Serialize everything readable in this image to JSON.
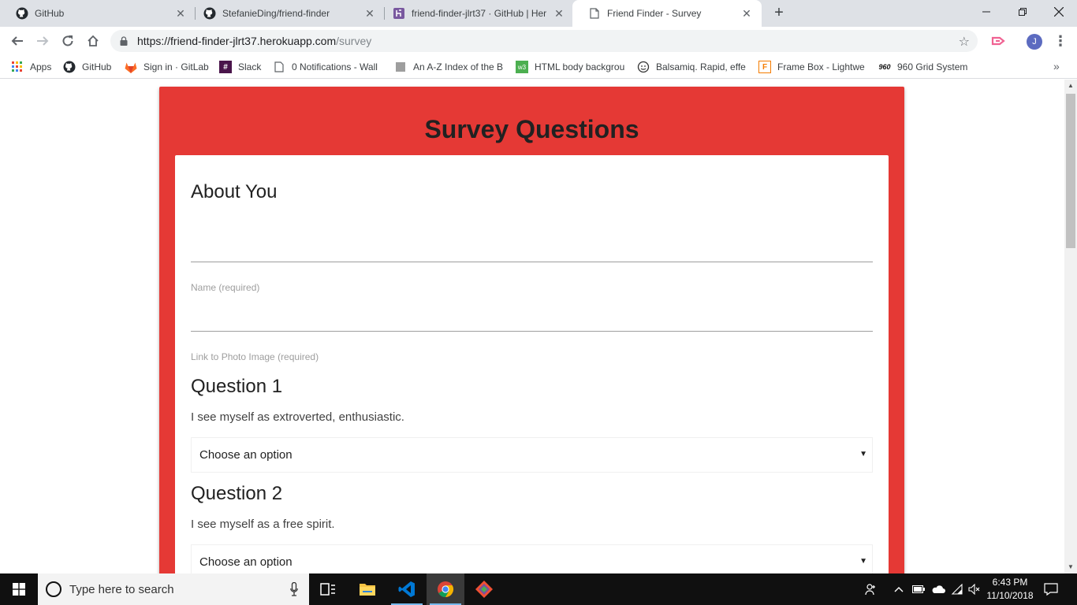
{
  "browser": {
    "tabs": [
      {
        "title": "GitHub",
        "icon": "github-icon",
        "active": false
      },
      {
        "title": "StefanieDing/friend-finder",
        "icon": "github-icon",
        "active": false
      },
      {
        "title": "friend-finder-jlrt37 · GitHub | Her",
        "icon": "heroku-icon",
        "active": false
      },
      {
        "title": "Friend Finder - Survey",
        "icon": "page-icon",
        "active": true
      }
    ],
    "url_host": "https://friend-finder-jlrt37.herokuapp.com",
    "url_path": "/survey",
    "profile_initial": "J",
    "bookmarks": [
      {
        "label": "Apps",
        "icon": "apps-grid-icon"
      },
      {
        "label": "GitHub",
        "icon": "github-icon"
      },
      {
        "label": "Sign in · GitLab",
        "icon": "gitlab-icon"
      },
      {
        "label": "Slack",
        "icon": "slack-icon"
      },
      {
        "label": "0 Notifications - Wall",
        "icon": "page-icon"
      },
      {
        "label": "An A-Z Index of the B",
        "icon": "page-icon"
      },
      {
        "label": "HTML body backgrou",
        "icon": "w3-icon"
      },
      {
        "label": "Balsamiq. Rapid, effe",
        "icon": "balsamiq-icon"
      },
      {
        "label": "Frame Box - Lightwe",
        "icon": "framebox-icon"
      },
      {
        "label": "960 Grid System",
        "icon": "960-icon"
      }
    ]
  },
  "page": {
    "title": "Survey Questions",
    "about_heading": "About You",
    "name_label": "Name (required)",
    "photo_label": "Link to Photo Image (required)",
    "questions": [
      {
        "heading": "Question 1",
        "text": "I see myself as extroverted, enthusiastic.",
        "selected": "Choose an option"
      },
      {
        "heading": "Question 2",
        "text": "I see myself as a free spirit.",
        "selected": "Choose an option"
      }
    ],
    "colors": {
      "panel": "#e53935",
      "card": "#ffffff"
    }
  },
  "taskbar": {
    "search_placeholder": "Type here to search",
    "time": "6:43 PM",
    "date": "11/10/2018"
  }
}
